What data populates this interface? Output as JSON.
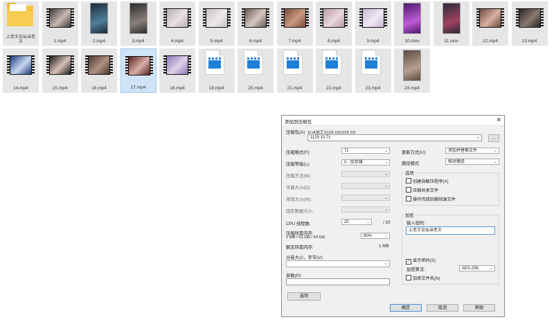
{
  "files_row1": [
    {
      "name": "上老王论坛当老王",
      "kind": "folder"
    },
    {
      "name": "1.mp4",
      "kind": "film",
      "c1": "#3a3a3a",
      "c2": "#c8b8b0"
    },
    {
      "name": "2.mp4",
      "kind": "portrait",
      "c1": "#1c2a3a",
      "c2": "#4f7f9a"
    },
    {
      "name": "3.mp4",
      "kind": "portrait",
      "c1": "#2a2a2a",
      "c2": "#8a7f7a"
    },
    {
      "name": "4.mp4",
      "kind": "film",
      "c1": "#b8b0b4",
      "c2": "#e8e0e2"
    },
    {
      "name": "5.mp4",
      "kind": "film",
      "c1": "#c8c2c0",
      "c2": "#eeeaea"
    },
    {
      "name": "6.mp4",
      "kind": "film",
      "c1": "#6a5a58",
      "c2": "#d8c8c0"
    },
    {
      "name": "7.mp4",
      "kind": "film",
      "c1": "#7a4a3a",
      "c2": "#c99a80"
    },
    {
      "name": "8.mp4",
      "kind": "film",
      "c1": "#b89aa0",
      "c2": "#e8d8dc"
    },
    {
      "name": "9.mp4",
      "kind": "film",
      "c1": "#c8b8d8",
      "c2": "#f0e8f4"
    },
    {
      "name": "10.mov",
      "kind": "portrait",
      "c1": "#4a1a6a",
      "c2": "#c05ad8"
    },
    {
      "name": "11.mov",
      "kind": "portrait",
      "c1": "#2a2a3a",
      "c2": "#a04060"
    },
    {
      "name": "12.mp4",
      "kind": "film",
      "c1": "#6a4a40",
      "c2": "#d8b0a0"
    },
    {
      "name": "13.mp4",
      "kind": "film",
      "c1": "#2a2222",
      "c2": "#8a7a70"
    }
  ],
  "files_row2": [
    {
      "name": "14.mp4",
      "kind": "film",
      "c1": "#1a3a7a",
      "c2": "#c8d8f0"
    },
    {
      "name": "15.mp4",
      "kind": "film",
      "c1": "#1a1a1a",
      "c2": "#d8c0b8"
    },
    {
      "name": "16.mp4",
      "kind": "film",
      "c1": "#4a3a30",
      "c2": "#b09080"
    },
    {
      "name": "17.mp4",
      "kind": "film",
      "c1": "#5a2020",
      "c2": "#d8b0a8",
      "selected": true
    },
    {
      "name": "18.mp4",
      "kind": "film",
      "c1": "#8a78b8",
      "c2": "#e0d0e8"
    },
    {
      "name": "19.mp4",
      "kind": "doc"
    },
    {
      "name": "20.mp4",
      "kind": "doc"
    },
    {
      "name": "21.mp4",
      "kind": "doc"
    },
    {
      "name": "22.mp4",
      "kind": "doc"
    },
    {
      "name": "23.mp4",
      "kind": "doc"
    },
    {
      "name": "24.mp4",
      "kind": "portrait",
      "c1": "#5a4a40",
      "c2": "#b8a090"
    }
  ],
  "dialog": {
    "title": "添加到压缩包",
    "archive_label": "压缩包(A)",
    "archive_path": "E:\\A加工\\1129 10\\1129 10\\",
    "archive_name": "1129 10.7z",
    "browse": "...",
    "format_label": "压缩格式(F):",
    "format_value": "7z",
    "level_label": "压缩等级(L):",
    "level_value": "0 - 仅存储",
    "method_label": "压缩方法(M):",
    "dict_label": "字典大小(D):",
    "word_label": "单词大小(W):",
    "solid_label": "固实数据大小:",
    "cpu_label": "CPU 线程数:",
    "cpu_value": "20",
    "cpu_max": "/ 20",
    "mem_label": "压缩所需内存:",
    "mem_info": "1 MB / 51 GB / 64 GB",
    "mem_value": "80%",
    "decomp_label": "解压所需内存:",
    "decomp_value": "1 MB",
    "split_label": "分卷大小，字节(V):",
    "params_label": "参数(P):",
    "options_btn": "选项",
    "update_label": "更新方式(U):",
    "update_value": "添加并替换文件",
    "pathmode_label": "路径模式",
    "pathmode_value": "相对路径",
    "options_group": "选项",
    "opt1": "创建自解压程序(X)",
    "opt2": "压缩共享文件",
    "opt3": "操作完成后删除源文件",
    "enc_group": "加密",
    "pwd_label": "输入密码:",
    "pwd_value": "上老王论坛当老王",
    "show_pwd": "显示密码(S)",
    "enc_method_label": "加密算法:",
    "enc_method_value": "AES-256",
    "enc_names": "加密文件名(N)",
    "ok": "确定",
    "cancel": "取消",
    "help": "帮助"
  }
}
